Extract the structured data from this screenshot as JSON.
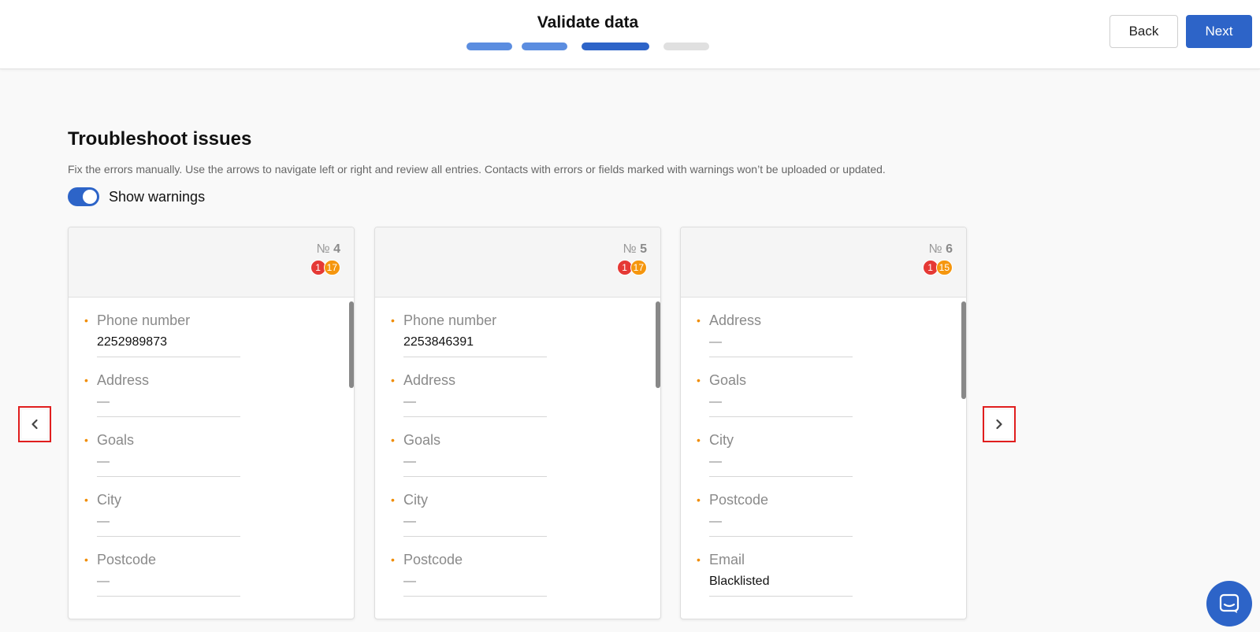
{
  "header": {
    "title": "Validate data",
    "back_label": "Back",
    "next_label": "Next",
    "steps_total": 4,
    "steps_current": 3
  },
  "main": {
    "heading": "Troubleshoot issues",
    "subtitle": "Fix the errors manually. Use the arrows to navigate left or right and review all entries. Contacts with errors or fields marked with warnings won’t be uploaded or updated.",
    "toggle_label": "Show warnings",
    "toggle_on": true
  },
  "cards": [
    {
      "no_prefix": "№",
      "no": "4",
      "errors": "1",
      "warnings": "17",
      "fields": [
        {
          "label": "Phone number",
          "value": "2252989873"
        },
        {
          "label": "Address",
          "value": "—"
        },
        {
          "label": "Goals",
          "value": "—"
        },
        {
          "label": "City",
          "value": "—"
        },
        {
          "label": "Postcode",
          "value": "—"
        }
      ]
    },
    {
      "no_prefix": "№",
      "no": "5",
      "errors": "1",
      "warnings": "17",
      "fields": [
        {
          "label": "Phone number",
          "value": "2253846391"
        },
        {
          "label": "Address",
          "value": "—"
        },
        {
          "label": "Goals",
          "value": "—"
        },
        {
          "label": "City",
          "value": "—"
        },
        {
          "label": "Postcode",
          "value": "—"
        }
      ]
    },
    {
      "no_prefix": "№",
      "no": "6",
      "errors": "1",
      "warnings": "15",
      "fields": [
        {
          "label": "Address",
          "value": "—"
        },
        {
          "label": "Goals",
          "value": "—"
        },
        {
          "label": "City",
          "value": "—"
        },
        {
          "label": "Postcode",
          "value": "—"
        },
        {
          "label": "Email",
          "value": "Blacklisted"
        }
      ]
    }
  ],
  "icons": {
    "prev": "chevron-left-icon",
    "next": "chevron-right-icon",
    "chat": "chat-icon"
  },
  "colors": {
    "accent": "#2d64c8",
    "error": "#e53935",
    "warning": "#f5960e",
    "highlight": "#e01e1e"
  }
}
